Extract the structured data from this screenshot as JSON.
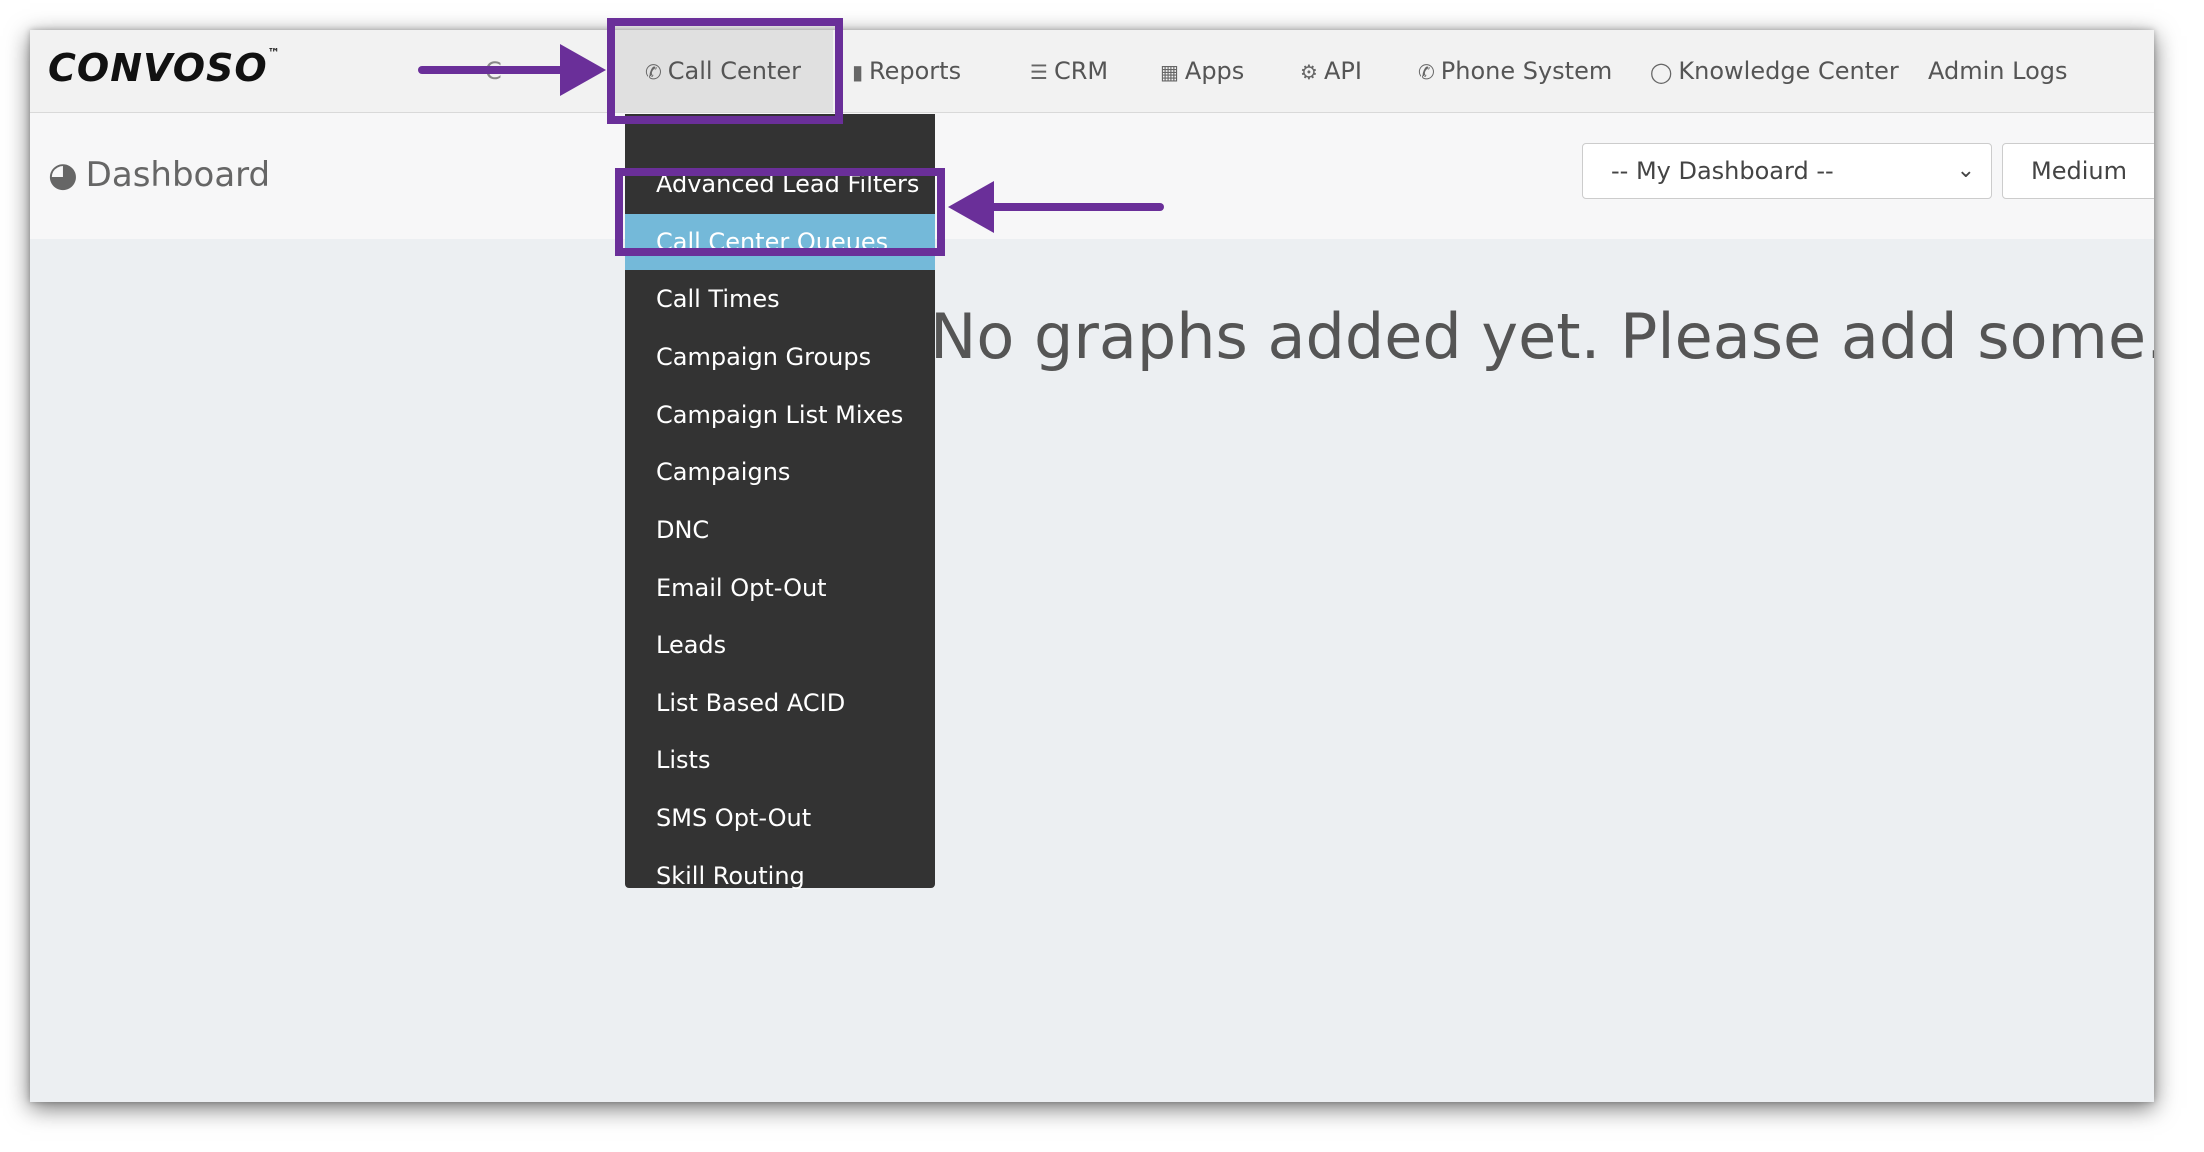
{
  "app": {
    "logo_text": "CONVOSO",
    "logo_mark": "™"
  },
  "nav": {
    "hidden_item": "C",
    "items": [
      {
        "label": "Call Center",
        "icon": "phone-icon"
      },
      {
        "label": "Reports",
        "icon": "bar-chart-icon"
      },
      {
        "label": "CRM",
        "icon": "list-icon"
      },
      {
        "label": "Apps",
        "icon": "grid-icon"
      },
      {
        "label": "API",
        "icon": "gear-icon"
      },
      {
        "label": "Phone System",
        "icon": "phone-icon"
      },
      {
        "label": "Knowledge Center",
        "icon": "lightbulb-icon"
      },
      {
        "label": "Admin Logs",
        "icon": ""
      }
    ],
    "active": "Call Center"
  },
  "dropdown": {
    "items": [
      "Advanced Lead Filters",
      "Call Center Queues",
      "Call Times",
      "Campaign Groups",
      "Campaign List Mixes",
      "Campaigns",
      "DNC",
      "Email Opt-Out",
      "Leads",
      "List Based ACID",
      "Lists",
      "SMS Opt-Out",
      "Skill Routing"
    ],
    "highlighted": "Call Center Queues"
  },
  "header": {
    "title": "Dashboard",
    "title_icon": "dashboard-gauge-icon",
    "dashboard_select": "-- My Dashboard --",
    "size_select": "Medium"
  },
  "main": {
    "empty_message": "No graphs added yet. Please add some."
  },
  "colors": {
    "annotation": "#6a2f99",
    "dropdown_bg": "#333333",
    "highlight": "#74b9d9"
  }
}
